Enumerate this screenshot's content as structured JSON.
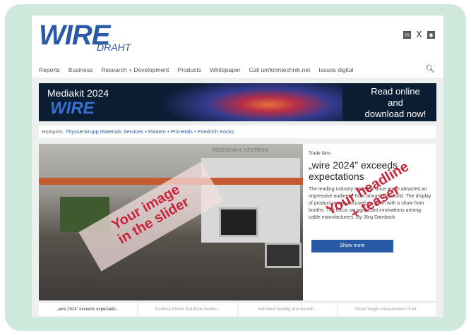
{
  "site": {
    "logo": "WIRE",
    "logo_sub": "DRAHT"
  },
  "social": [
    "in",
    "X",
    "rss"
  ],
  "nav": [
    "Reports",
    "Business",
    "Research + Development",
    "Products",
    "Whitepaper",
    "Call umformtechnik.net",
    "Issues digital"
  ],
  "banner": {
    "title": "Mediakit 2024",
    "brand": "WIRE",
    "cta_line1": "Read online",
    "cta_line2": "and",
    "cta_line3": "download now!"
  },
  "hotspots": {
    "label": "Hotspots:",
    "items": [
      "Thyssenkrupp Materials Services",
      "Madem",
      "Primetals",
      "Friedrich Kocks"
    ]
  },
  "slider": {
    "booth_sign": "ROSENDAHL NEXTROM",
    "overlay_line1": "Your image",
    "overlay_line2": "in the slider"
  },
  "teaser": {
    "kicker": "Trade fairs",
    "headline": "„wire 2024” exceeds expectations",
    "body": "The leading industry trade fair once again attracted an impressive audience from around the world. The display of product ranges focused on Bonn with a show from booths. The focus on significant innovations among cable manufacturers.",
    "author": "By Jörg Dambock",
    "button": "Show more",
    "overlay_line1": "Your headline",
    "overlay_line2": "+ teaser"
  },
  "thumbs": [
    "„wire 2024” exceeds expectatio...",
    "Danfoss Power Solutions names...",
    "Individual heating and warmth...",
    "Smart length measurement of wi..."
  ]
}
